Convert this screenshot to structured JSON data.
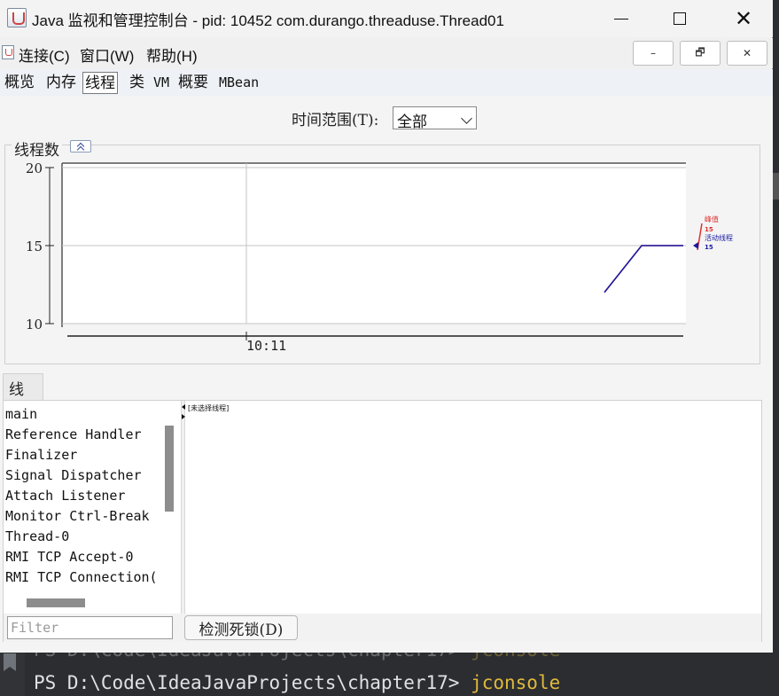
{
  "window": {
    "title": "Java 监视和管理控制台 - pid: 10452 com.durango.threaduse.Thread01"
  },
  "menu": {
    "connect": "连接(C)",
    "window": "窗口(W)",
    "help": "帮助(H)"
  },
  "mdi_buttons": {
    "minimize": "–",
    "restore": "🗗",
    "close": "✕"
  },
  "tabs": [
    {
      "label": "概览",
      "selected": false
    },
    {
      "label": "内存",
      "selected": false
    },
    {
      "label": "线程",
      "selected": true
    },
    {
      "label": "类",
      "selected": false
    },
    {
      "label": "VM",
      "selected": false
    },
    {
      "label": "概要",
      "selected": false
    },
    {
      "label": "MBean",
      "selected": false
    }
  ],
  "time_range": {
    "label": "时间范围(T):",
    "value": "全部"
  },
  "chart_data": {
    "type": "line",
    "title": "线程数",
    "ylim": [
      10,
      20
    ],
    "y_ticks": [
      "20",
      "15",
      "10"
    ],
    "x_ticks": [
      "10:11"
    ],
    "grid": true,
    "series": [
      {
        "name": "峰值",
        "value_label": "15",
        "color": "#e03030",
        "values": [
          12,
          15,
          15
        ]
      },
      {
        "name": "活动线程",
        "value_label": "15",
        "color": "#1a1aa0",
        "values": [
          12,
          15,
          15
        ]
      }
    ]
  },
  "threads": {
    "tab_label": "线程",
    "items": [
      "main",
      "Reference Handler",
      "Finalizer",
      "Signal Dispatcher",
      "Attach Listener",
      "Monitor Ctrl-Break",
      "Thread-0",
      "RMI TCP Accept-0",
      "RMI TCP Connection("
    ],
    "detail_placeholder": "[未选择线程]",
    "filter_placeholder": "Filter",
    "deadlock_button": "检测死锁(D)"
  },
  "terminal": {
    "prompt": "PS D:\\Code\\IdeaJavaProjects\\chapter17>",
    "command": "jconsole"
  }
}
